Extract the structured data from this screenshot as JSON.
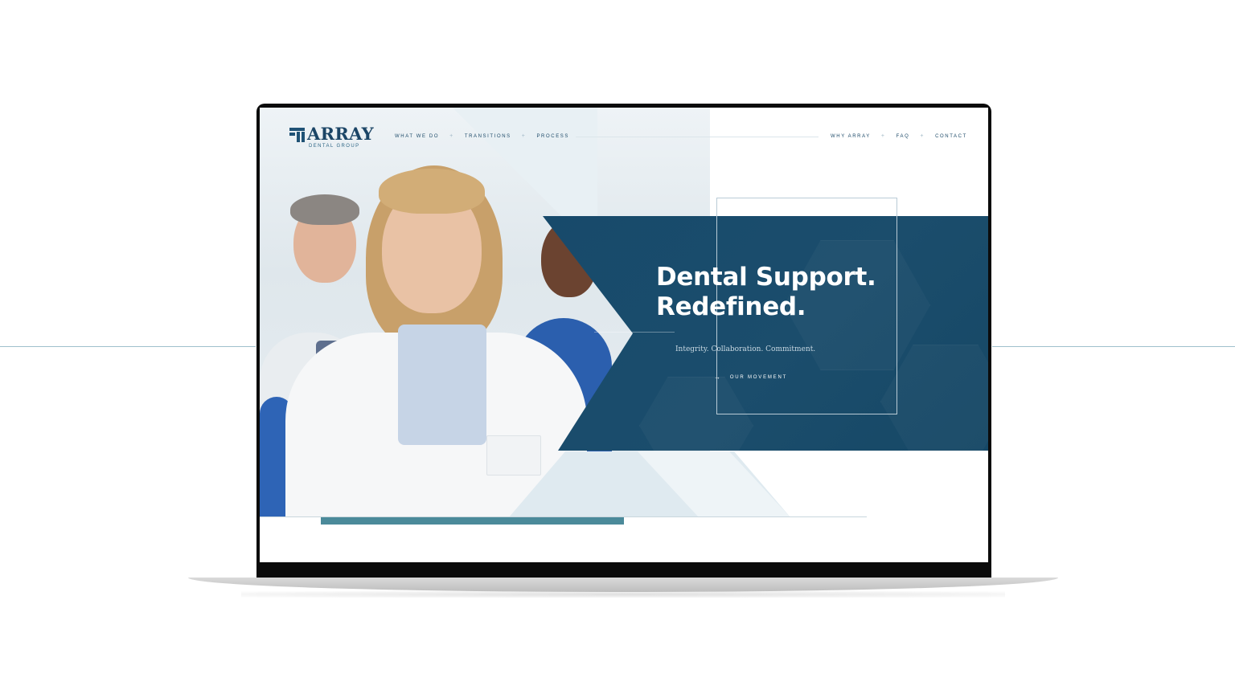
{
  "brand": {
    "name": "ARRAY",
    "subtitle": "DENTAL GROUP"
  },
  "nav": {
    "left": [
      {
        "label": "WHAT WE DO"
      },
      {
        "label": "TRANSITIONS"
      },
      {
        "label": "PROCESS"
      }
    ],
    "right": [
      {
        "label": "WHY ARRAY"
      },
      {
        "label": "FAQ"
      },
      {
        "label": "CONTACT"
      }
    ],
    "separator": "+"
  },
  "hero": {
    "title_line1": "Dental Support.",
    "title_line2": "Redefined.",
    "tagline": "Integrity. Collaboration. Commitment.",
    "cta_label": "OUR MOVEMENT",
    "cta_icon": "arrow-right-icon"
  },
  "colors": {
    "navy": "#174a6b",
    "accent_teal": "#4b8a9a",
    "logo": "#1b4566"
  },
  "slider": {
    "progress": 0.5
  }
}
